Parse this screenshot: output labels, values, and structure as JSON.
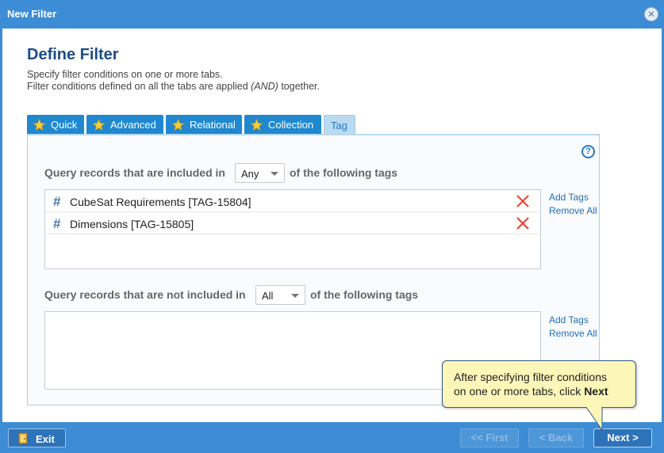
{
  "window": {
    "title": "New Filter",
    "close_icon": "close-circle-icon"
  },
  "header": {
    "title": "Define Filter",
    "line1": "Specify filter conditions on one or more tabs.",
    "line2_prefix": "Filter conditions defined on all the tabs are applied ",
    "line2_em": "(AND)",
    "line2_suffix": " together."
  },
  "tabs": [
    {
      "label": "Quick",
      "icon": "star-icon",
      "active": false
    },
    {
      "label": "Advanced",
      "icon": "star-icon",
      "active": false
    },
    {
      "label": "Relational",
      "icon": "star-icon",
      "active": false
    },
    {
      "label": "Collection",
      "icon": "star-icon",
      "active": false
    },
    {
      "label": "Tag",
      "active": true
    }
  ],
  "included": {
    "label_prefix": "Query records that are included in",
    "select_value": "Any",
    "label_suffix": "of the following tags",
    "tags": [
      {
        "name": "CubeSat Requirements [TAG-15804]"
      },
      {
        "name": "Dimensions [TAG-15805]"
      }
    ],
    "add_link": "Add Tags",
    "remove_link": "Remove All"
  },
  "excluded": {
    "label_prefix": "Query records that are not included in",
    "select_value": "All",
    "label_suffix": "of the following tags",
    "tags": [],
    "add_link": "Add Tags",
    "remove_link": "Remove All"
  },
  "tooltip": {
    "line1": "After specifying filter conditions",
    "line2_prefix": "on one or more tabs, click ",
    "line2_bold": "Next"
  },
  "footer": {
    "exit_label": "Exit",
    "first_label": "<< First",
    "back_label": "< Back",
    "next_label": "Next >"
  },
  "colors": {
    "chrome_blue": "#3c8dd5",
    "tab_blue": "#1f88cf",
    "active_tab": "#b9daf0",
    "heading": "#1d4d86",
    "delete_red": "#e8412a",
    "tooltip_bg": "#fdf6b9"
  }
}
